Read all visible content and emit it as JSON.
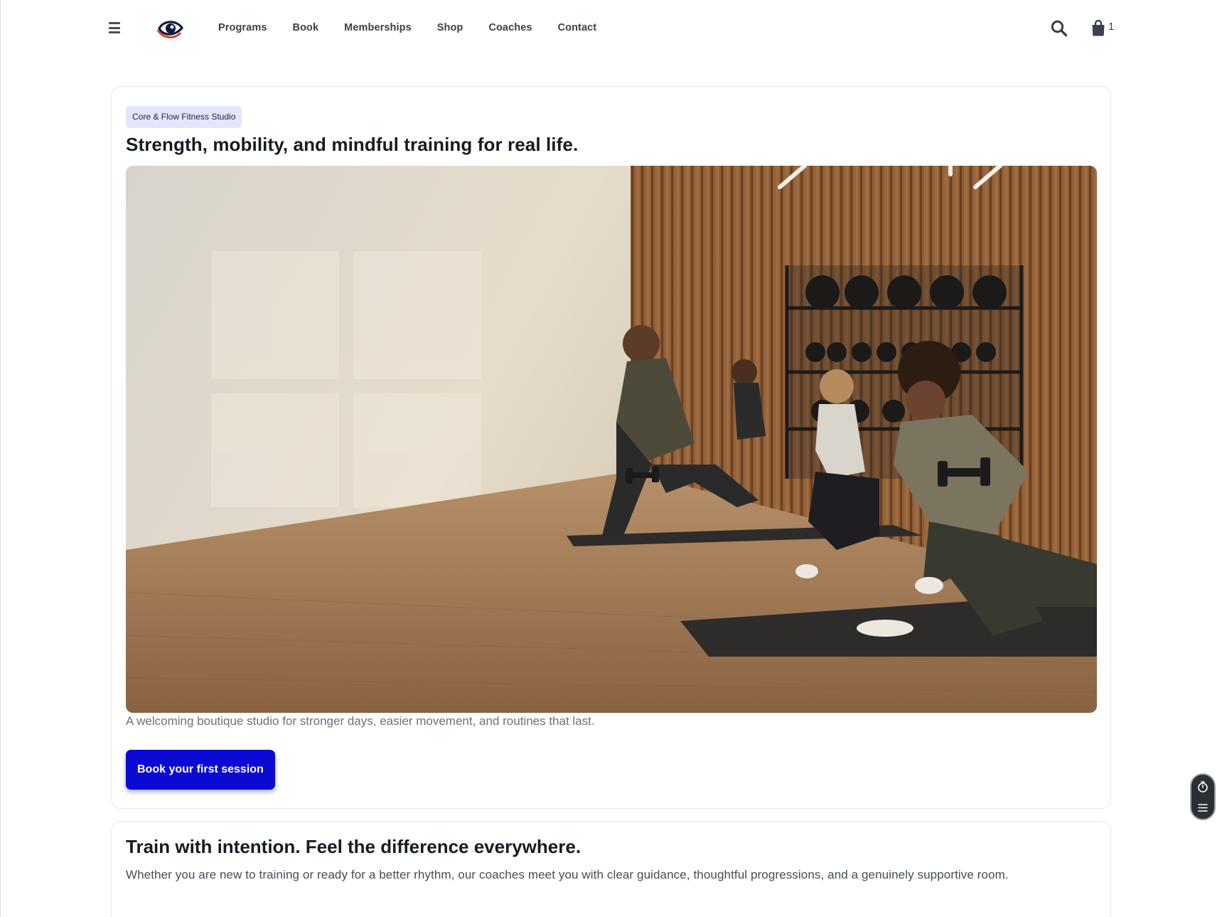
{
  "header": {
    "nav": [
      "Programs",
      "Book",
      "Memberships",
      "Shop",
      "Coaches",
      "Contact"
    ],
    "cart_count": "1",
    "icons": {
      "menu": "menu-icon",
      "logo": "eye-logo",
      "search": "search-icon",
      "cart": "shopping-bag-icon"
    }
  },
  "hero": {
    "badge": "Core & Flow Fitness Studio",
    "title": "Strength, mobility, and mindful training for real life.",
    "image_alt": "Group fitness class doing kneeling dumbbell exercises on mats in a sunlit wood-paneled studio",
    "subtitle": "A welcoming boutique studio for stronger days, easier movement, and routines that last.",
    "cta_label": "Book your first session"
  },
  "intro": {
    "title": "Train with intention. Feel the difference everywhere.",
    "text": "Whether you are new to training or ready for a better rhythm, our coaches meet you with clear guidance, thoughtful progressions, and a genuinely supportive room."
  },
  "widget": {
    "icons": [
      "timer-icon",
      "list-icon"
    ]
  },
  "colors": {
    "accent": "#0a0ad2",
    "badge_bg": "#e4e6fb",
    "logo_red": "#d2452c",
    "logo_navy": "#0f1a3c"
  }
}
